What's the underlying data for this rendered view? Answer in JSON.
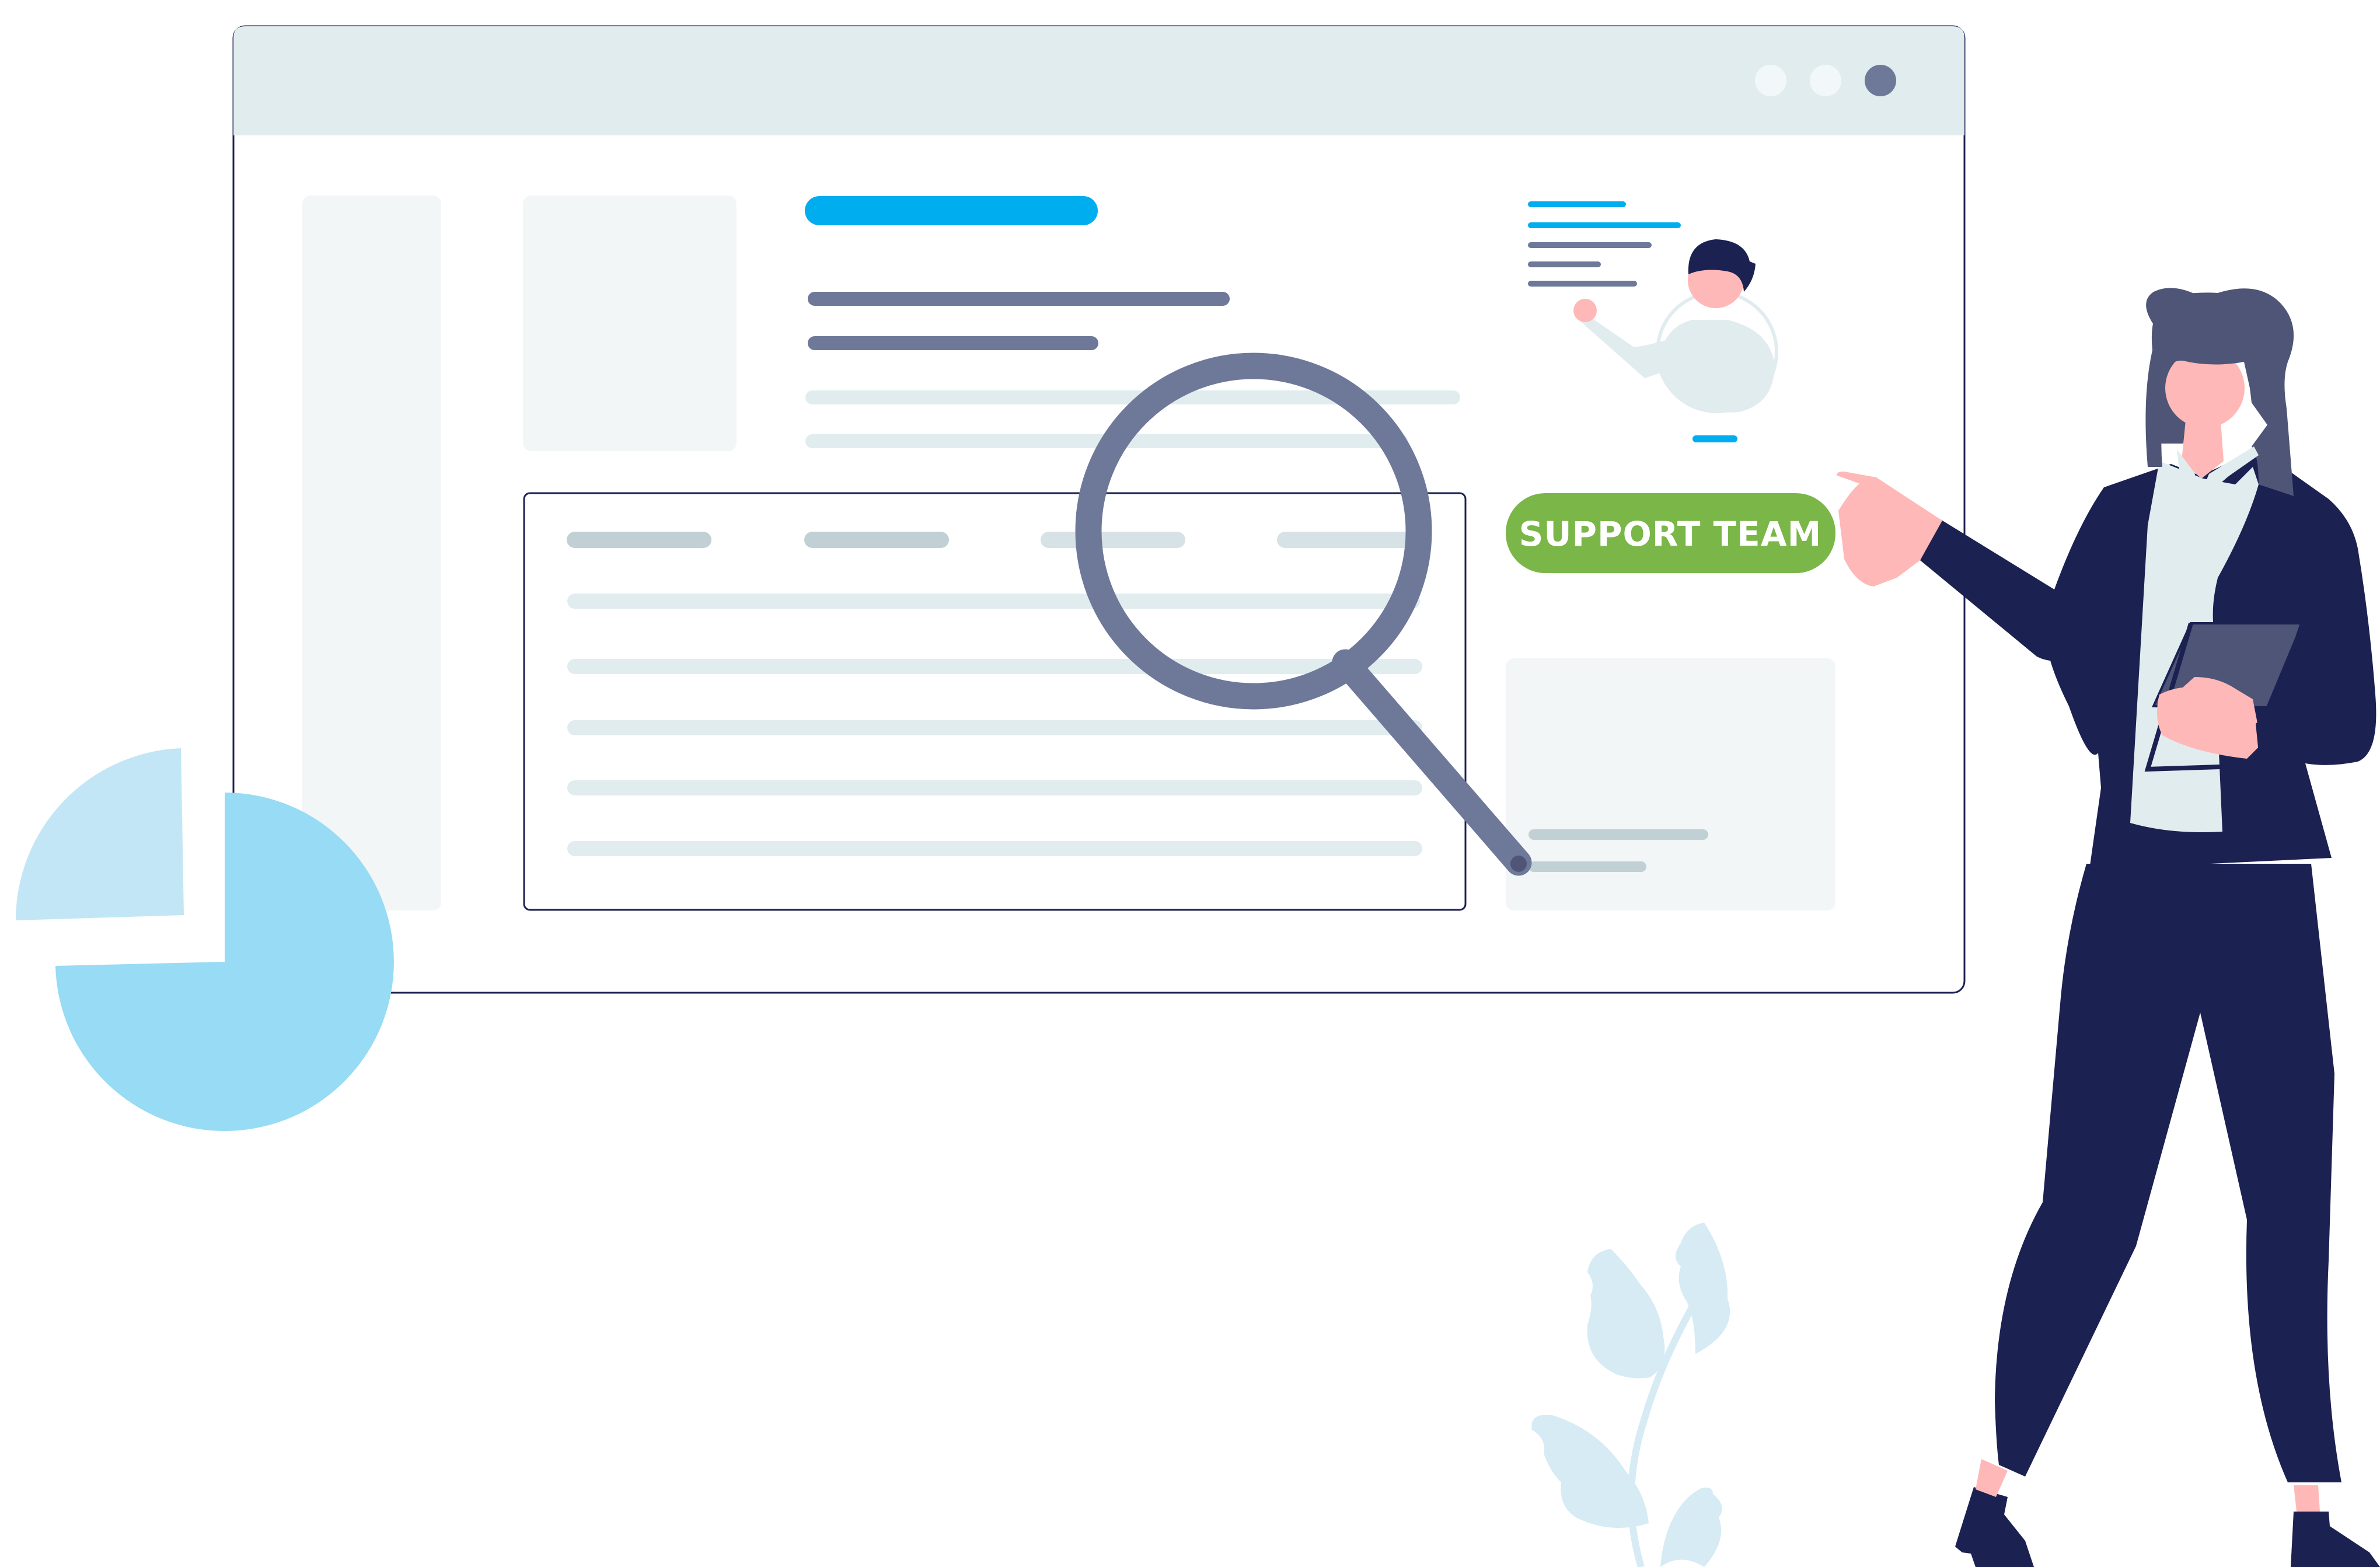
{
  "support_button": {
    "label": "SUPPORT TEAM"
  },
  "window": {
    "titlebar_dots": [
      "dot-light",
      "dot-light",
      "dot-active"
    ]
  },
  "colors": {
    "accent_blue": "#00ADEF",
    "button_green": "#7AB648",
    "navy": "#1B2151",
    "slate": "#6E7899",
    "skin": "#FFB8B8",
    "light_blue": "#97DBF4",
    "pale_blue": "#C2E6F5",
    "titlebar": "#E1ECEF",
    "panel": "#F2F6F7",
    "line_light": "#E1ECEF",
    "line_mid": "#C0D0D5",
    "hair": "#4E5577"
  },
  "icons": [
    "magnifier-icon",
    "pie-chart-icon",
    "leaf-plant-icon",
    "agent-avatar-icon"
  ]
}
